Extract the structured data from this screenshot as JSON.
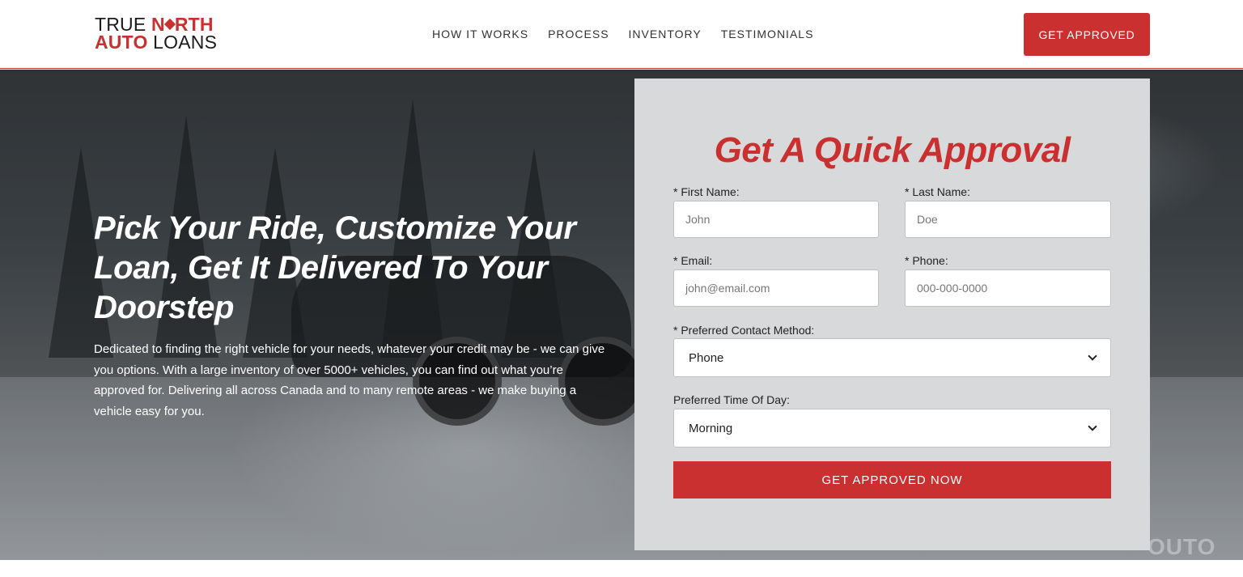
{
  "logo": {
    "line1_a": "TRUE ",
    "line1_b": "N",
    "line1_c": "RTH",
    "line2_a": "AUTO",
    "line2_b": " LOANS"
  },
  "nav": {
    "items": [
      {
        "label": "HOW IT WORKS"
      },
      {
        "label": "PROCESS"
      },
      {
        "label": "INVENTORY"
      },
      {
        "label": "TESTIMONIALS"
      }
    ]
  },
  "header": {
    "cta_label": "GET APPROVED"
  },
  "hero": {
    "title": "Pick Your Ride, Customize Your Loan, Get It Delivered To Your Doorstep",
    "text": "Dedicated to finding the right vehicle for your needs, whatever your credit may be - we can give you options. With a large inventory of over 5000+ vehicles, you can find out what you’re approved for. Delivering all across Canada and to many remote areas - we make buying a vehicle easy for you."
  },
  "form": {
    "title": "Get A Quick Approval",
    "first_name": {
      "label": "* First Name:",
      "placeholder": "John"
    },
    "last_name": {
      "label": "* Last Name:",
      "placeholder": "Doe"
    },
    "email": {
      "label": "* Email:",
      "placeholder": "john@email.com"
    },
    "phone": {
      "label": "* Phone:",
      "placeholder": "000-000-0000"
    },
    "contact_method": {
      "label": "* Preferred Contact Method:",
      "value": "Phone"
    },
    "time_of_day": {
      "label": "Preferred Time Of Day:",
      "value": "Morning"
    },
    "submit_label": "GET APPROVED NOW"
  },
  "watermark": "OUTO",
  "colors": {
    "accent": "#c9302f",
    "panel_bg": "#d8d9da"
  }
}
